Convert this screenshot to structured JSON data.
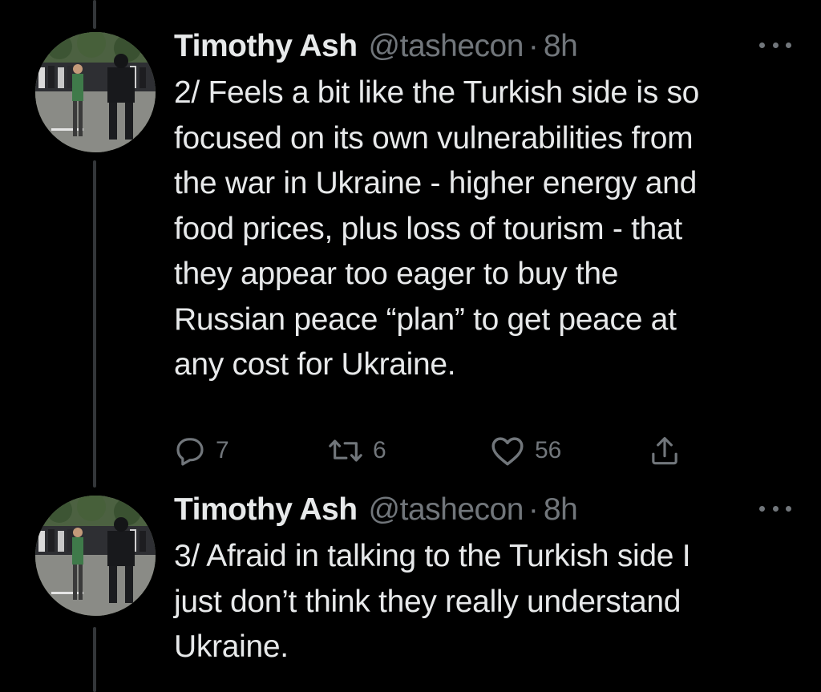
{
  "tweets": [
    {
      "author": "Timothy Ash",
      "handle": "@tashecon",
      "separator": "·",
      "time": "8h",
      "text": "2/ Feels a bit like the Turkish side is so\nfocused on its own vulnerabilities from\nthe war in Ukraine - higher energy and\nfood prices, plus loss of tourism - that\nthey appear too eager to buy the\nRussian peace “plan” to get peace at\nany cost for Ukraine.",
      "replies": "7",
      "retweets": "6",
      "likes": "56",
      "icons": [
        "reply-icon",
        "retweet-icon",
        "like-icon",
        "share-icon",
        "more-icon"
      ]
    },
    {
      "author": "Timothy Ash",
      "handle": "@tashecon",
      "separator": "·",
      "time": "8h",
      "text": "3/ Afraid in talking to the Turkish side I\njust don’t think they really understand\nUkraine.",
      "icons": [
        "more-icon"
      ]
    }
  ],
  "colors": {
    "background": "#000000",
    "primary_text": "#e7e9ea",
    "secondary_text": "#71767b",
    "thread_line": "#333639"
  }
}
